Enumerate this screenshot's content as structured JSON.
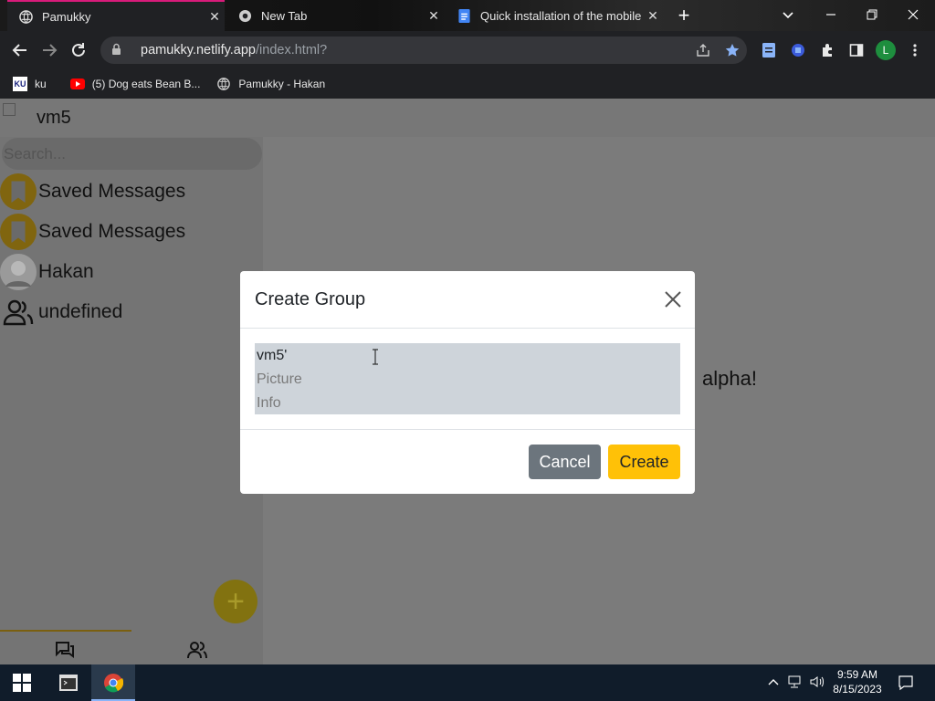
{
  "browser": {
    "tabs": [
      {
        "title": "Pamukky",
        "close": "✕"
      },
      {
        "title": "New Tab",
        "close": "✕"
      },
      {
        "title": "Quick installation of the mobile s",
        "close": "✕"
      }
    ],
    "new_tab": "+",
    "url_host": "pamukky.netlify.app",
    "url_path": "/index.html?",
    "profile_initial": "L",
    "bookmarks": [
      {
        "label": "ku",
        "icon_text": "KU"
      },
      {
        "label": "(5) Dog eats Bean B..."
      },
      {
        "label": "Pamukky - Hakan"
      }
    ]
  },
  "app": {
    "header_title": "vm5",
    "search_placeholder": "Search...",
    "chats": [
      {
        "name": "Saved Messages",
        "icon": "bookmark-icon"
      },
      {
        "name": "Saved Messages",
        "icon": "bookmark-icon"
      },
      {
        "name": "Hakan",
        "icon": "avatar"
      },
      {
        "name": "undefined",
        "icon": "group-icon"
      }
    ],
    "main_text": "alpha!",
    "fab_label": "+"
  },
  "modal": {
    "title": "Create Group",
    "name_value": "vm5'",
    "picture_placeholder": "Picture",
    "info_placeholder": "Info",
    "cancel_label": "Cancel",
    "create_label": "Create"
  },
  "taskbar": {
    "time": "9:59 AM",
    "date": "8/15/2023"
  },
  "colors": {
    "accent": "#ffc107",
    "cancel": "#6c757d",
    "tab_accent": "#d81b7a"
  }
}
